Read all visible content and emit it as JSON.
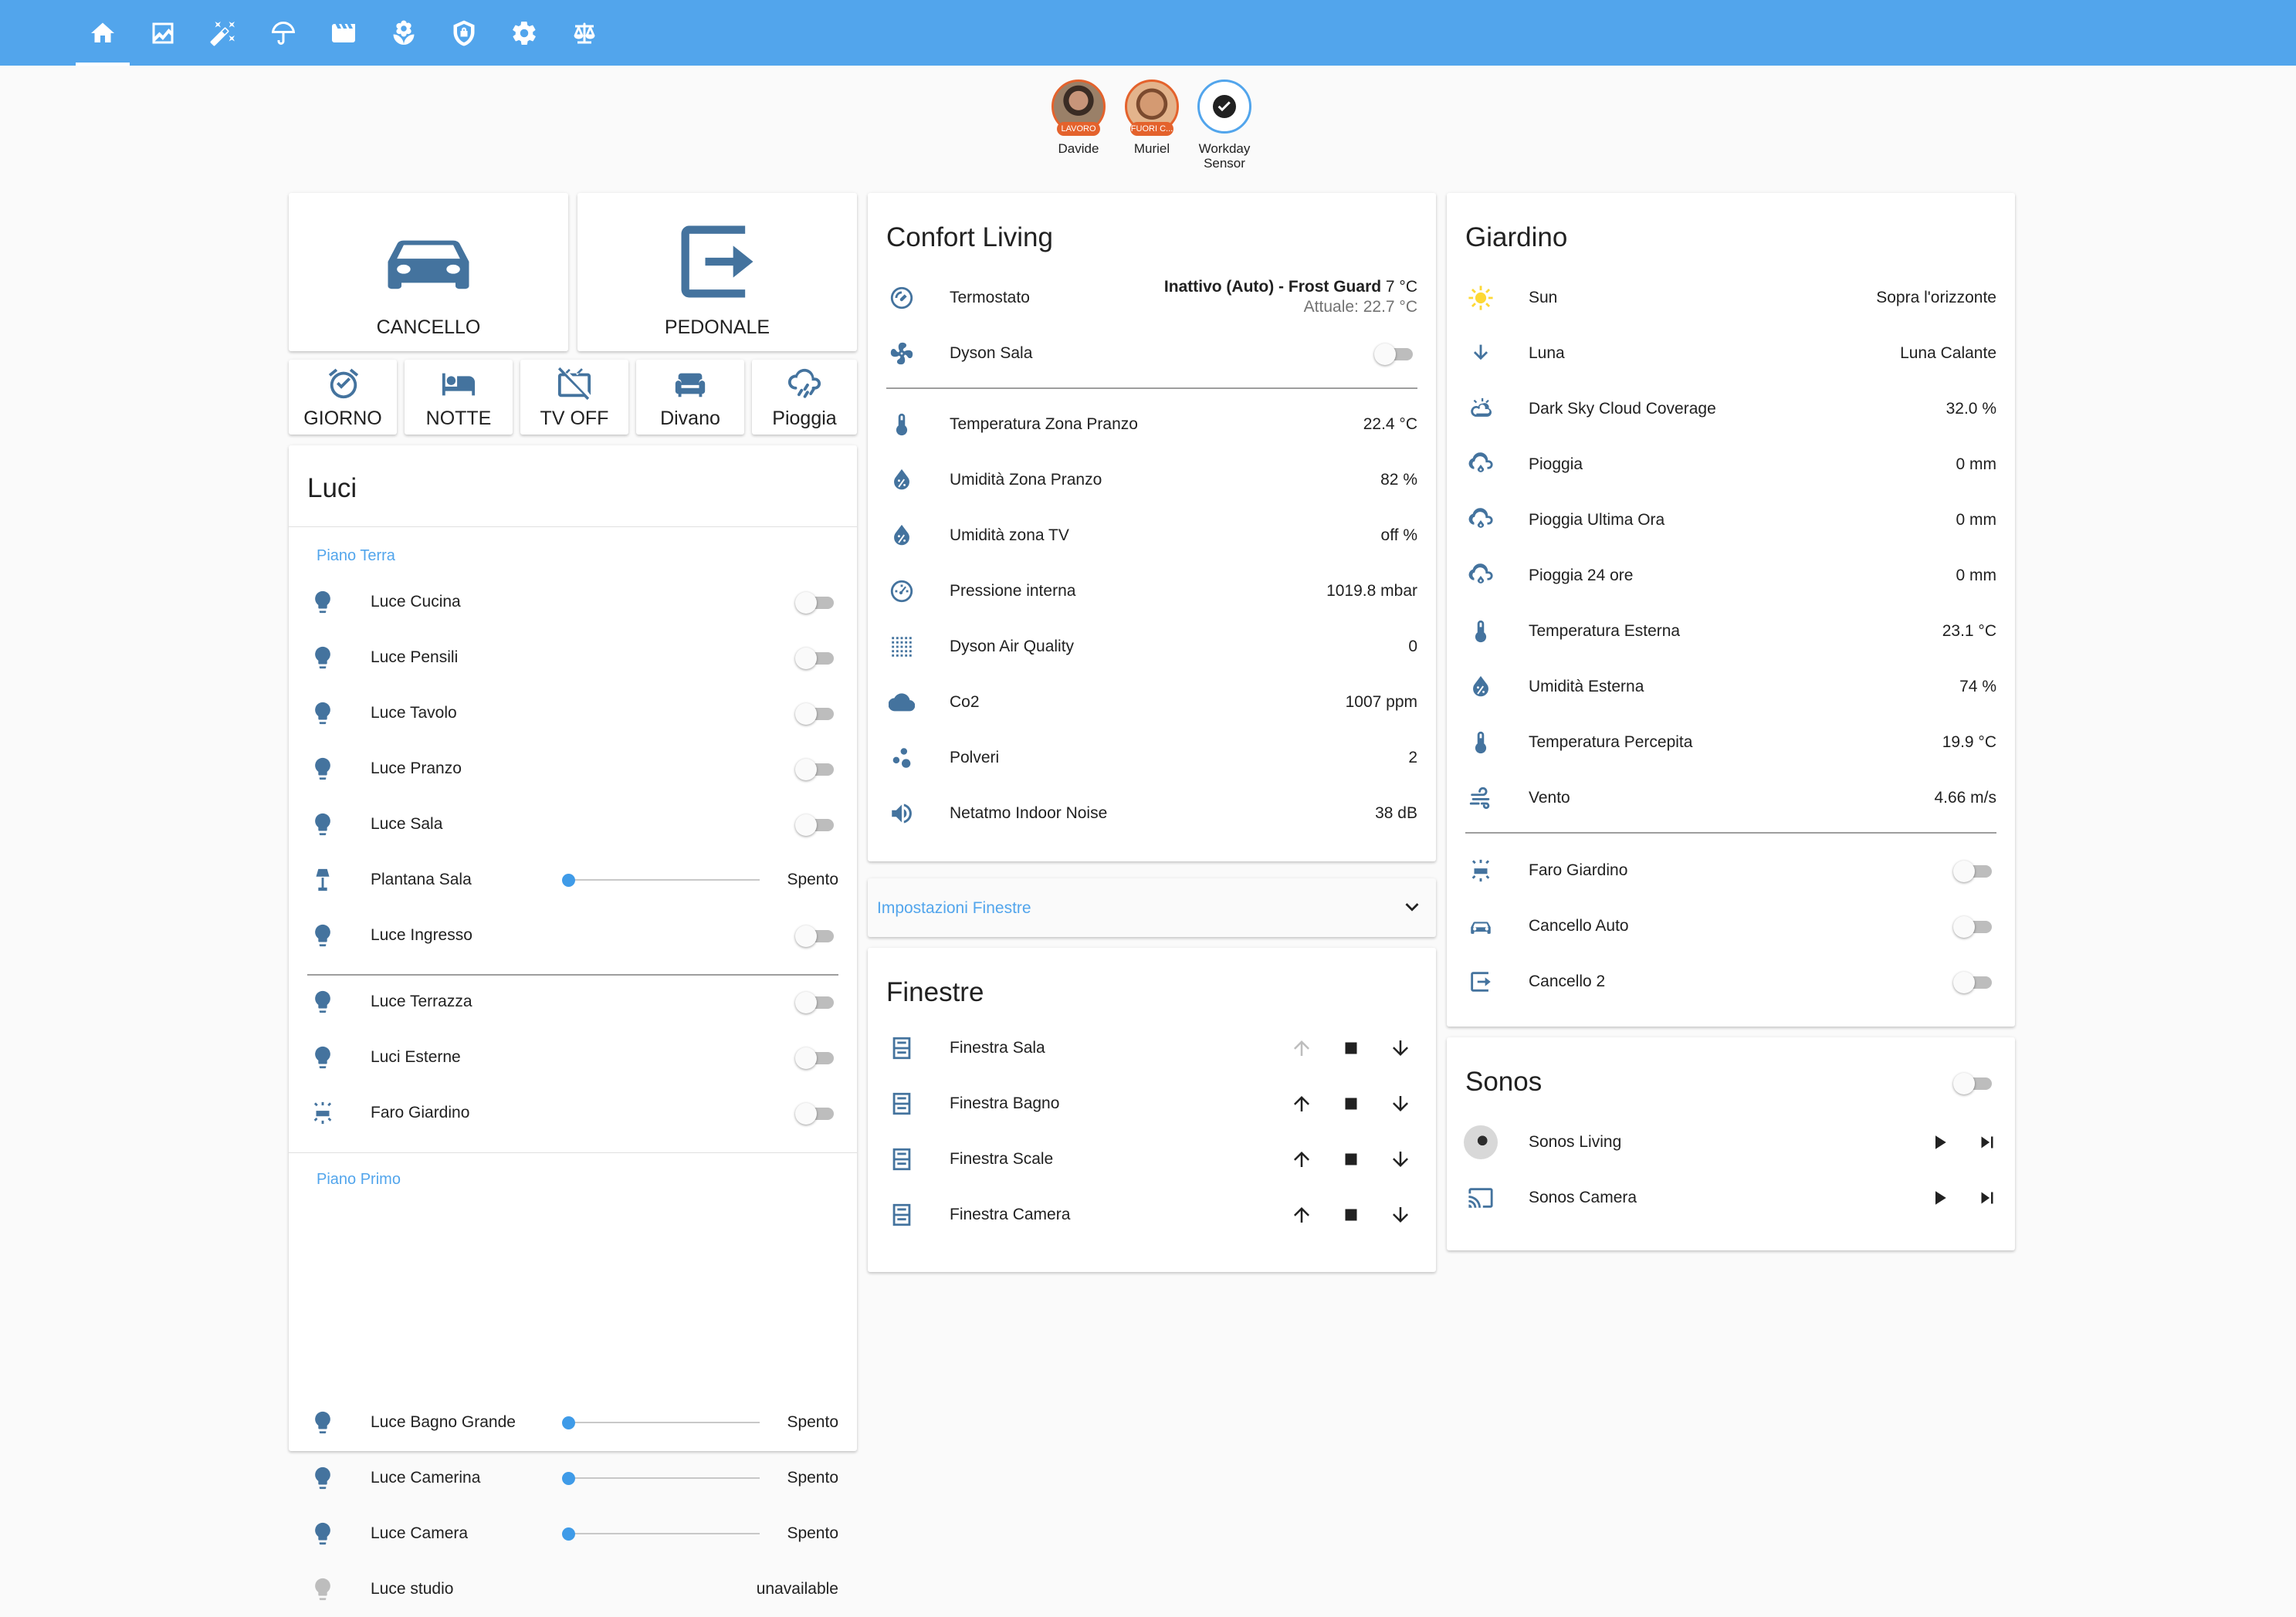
{
  "colors": {
    "header": "#52a5ec",
    "icon": "#44739e",
    "accent": "#3f9be8",
    "person_badge": "#e4622c"
  },
  "tabs": [
    {
      "icon": "home-icon",
      "active": true
    },
    {
      "icon": "chart-icon"
    },
    {
      "icon": "magic-wand-icon"
    },
    {
      "icon": "umbrella-icon"
    },
    {
      "icon": "clapperboard-icon"
    },
    {
      "icon": "flower-icon"
    },
    {
      "icon": "shield-icon"
    },
    {
      "icon": "gear-icon"
    },
    {
      "icon": "scale-icon"
    }
  ],
  "badges": [
    {
      "name": "Davide",
      "state": "LAVORO"
    },
    {
      "name": "Muriel",
      "state": "FUORI C..."
    },
    {
      "name": "Workday Sensor"
    }
  ],
  "buttons": {
    "cancello": "CANCELLO",
    "pedonale": "PEDONALE"
  },
  "scenes": [
    "GIORNO",
    "NOTTE",
    "TV OFF",
    "Divano",
    "Pioggia"
  ],
  "luci": {
    "title": "Luci",
    "piano_terra": "Piano Terra",
    "piano_primo": "Piano Primo",
    "items": [
      {
        "name": "Luce Cucina",
        "type": "toggle"
      },
      {
        "name": "Luce Pensili",
        "type": "toggle"
      },
      {
        "name": "Luce Tavolo",
        "type": "toggle"
      },
      {
        "name": "Luce Pranzo",
        "type": "toggle"
      },
      {
        "name": "Luce Sala",
        "type": "toggle"
      },
      {
        "name": "Plantana Sala",
        "type": "slider",
        "state": "Spento"
      },
      {
        "name": "Luce Ingresso",
        "type": "toggle"
      },
      {
        "name": "Luce Terrazza",
        "type": "toggle"
      },
      {
        "name": "Luci Esterne",
        "type": "toggle"
      },
      {
        "name": "Faro Giardino",
        "type": "toggle"
      },
      {
        "name": "Luce Bagno Grande",
        "type": "slider",
        "state": "Spento"
      },
      {
        "name": "Luce Camerina",
        "type": "slider",
        "state": "Spento"
      },
      {
        "name": "Luce Camera",
        "type": "slider",
        "state": "Spento"
      },
      {
        "name": "Luce studio",
        "type": "text",
        "state": "unavailable"
      }
    ]
  },
  "confort": {
    "title": "Confort Living",
    "termostato": {
      "name": "Termostato",
      "state": "Inattivo (Auto) - Frost Guard",
      "target": "7 °C",
      "current": "Attuale: 22.7 °C"
    },
    "dyson": "Dyson Sala",
    "sensors": [
      {
        "name": "Temperatura Zona Pranzo",
        "value": "22.4 °C"
      },
      {
        "name": "Umidità Zona Pranzo",
        "value": "82 %"
      },
      {
        "name": "Umidità zona TV",
        "value": "off %"
      },
      {
        "name": "Pressione interna",
        "value": "1019.8 mbar"
      },
      {
        "name": "Dyson Air Quality",
        "value": "0"
      },
      {
        "name": "Co2",
        "value": "1007 ppm"
      },
      {
        "name": "Polveri",
        "value": "2"
      },
      {
        "name": "Netatmo Indoor Noise",
        "value": "38 dB"
      }
    ]
  },
  "impostazioni": "Impostazioni Finestre",
  "finestre": {
    "title": "Finestre",
    "items": [
      "Finestra Sala",
      "Finestra Bagno",
      "Finestra Scale",
      "Finestra Camera"
    ]
  },
  "giardino": {
    "title": "Giardino",
    "sensors": [
      {
        "name": "Sun",
        "value": "Sopra l'orizzonte"
      },
      {
        "name": "Luna",
        "value": "Luna Calante"
      },
      {
        "name": "Dark Sky Cloud Coverage",
        "value": "32.0 %"
      },
      {
        "name": "Pioggia",
        "value": "0 mm"
      },
      {
        "name": "Pioggia Ultima Ora",
        "value": "0 mm"
      },
      {
        "name": "Pioggia 24 ore",
        "value": "0 mm"
      },
      {
        "name": "Temperatura Esterna",
        "value": "23.1 °C"
      },
      {
        "name": "Umidità Esterna",
        "value": "74 %"
      },
      {
        "name": "Temperatura Percepita",
        "value": "19.9 °C"
      },
      {
        "name": "Vento",
        "value": "4.66 m/s"
      }
    ],
    "switches": [
      "Faro Giardino",
      "Cancello Auto",
      "Cancello 2"
    ]
  },
  "sonos": {
    "title": "Sonos",
    "items": [
      "Sonos Living",
      "Sonos Camera"
    ]
  }
}
